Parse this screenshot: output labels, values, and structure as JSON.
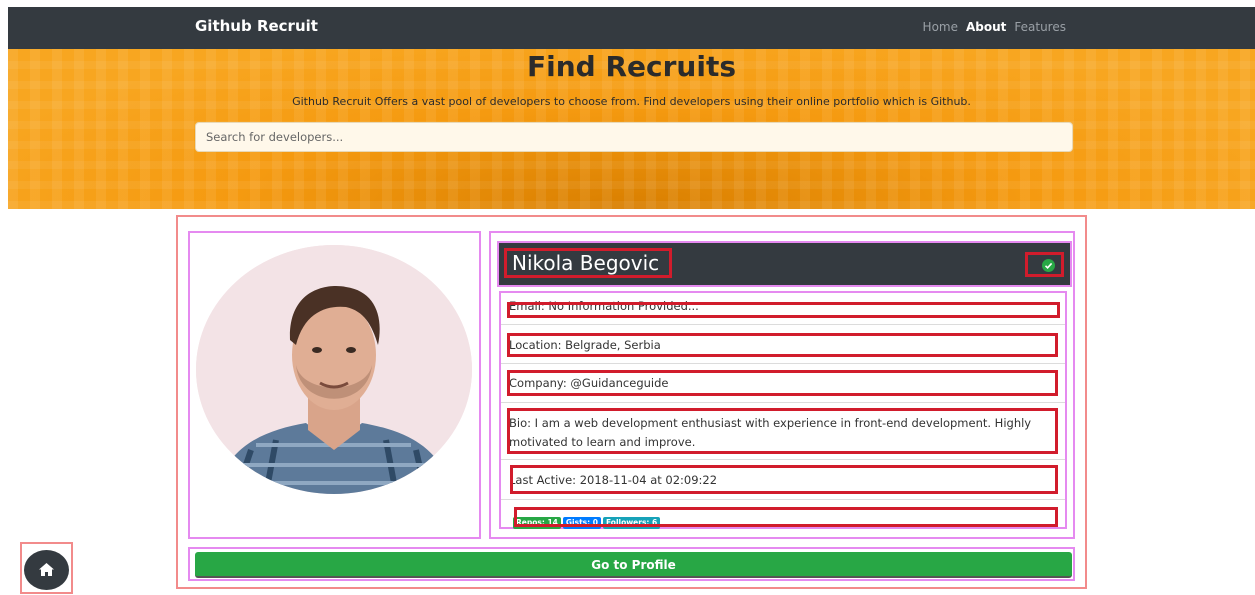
{
  "navbar": {
    "brand": "Github Recruit",
    "links": [
      {
        "label": "Home",
        "active": false
      },
      {
        "label": "About",
        "active": true
      },
      {
        "label": "Features",
        "active": false
      }
    ]
  },
  "hero": {
    "title": "Find Recruits",
    "subtitle": "Github Recruit Offers a vast pool of developers to choose from. Find developers using their online portfolio which is Github.",
    "search_placeholder": "Search for developers..."
  },
  "profile": {
    "name": "Nikola Begovic",
    "verified_icon": "check-circle-icon",
    "details": [
      {
        "text": "Email: No Information Provided..."
      },
      {
        "text": "Location: Belgrade, Serbia"
      },
      {
        "text": "Company: @Guidanceguide"
      },
      {
        "text": "Bio: I am a web development enthusiast with experience in front-end development. Highly motivated to learn and improve."
      },
      {
        "text": "Last Active: 2018-11-04 at 02:09:22"
      }
    ],
    "badges": [
      {
        "label": "Repos: 14",
        "color": "#28a745"
      },
      {
        "label": "Gists: 0",
        "color": "#007bff"
      },
      {
        "label": "Followers: 6",
        "color": "#17a2b8"
      }
    ],
    "button_label": "Go to Profile"
  },
  "home_button": {
    "icon": "home-icon"
  },
  "colors": {
    "navbar": "#343a40",
    "hero": "#f8a620",
    "highlight_red": "#d11c2c",
    "highlight_pink": "#e58af0",
    "button_green": "#28a745"
  }
}
